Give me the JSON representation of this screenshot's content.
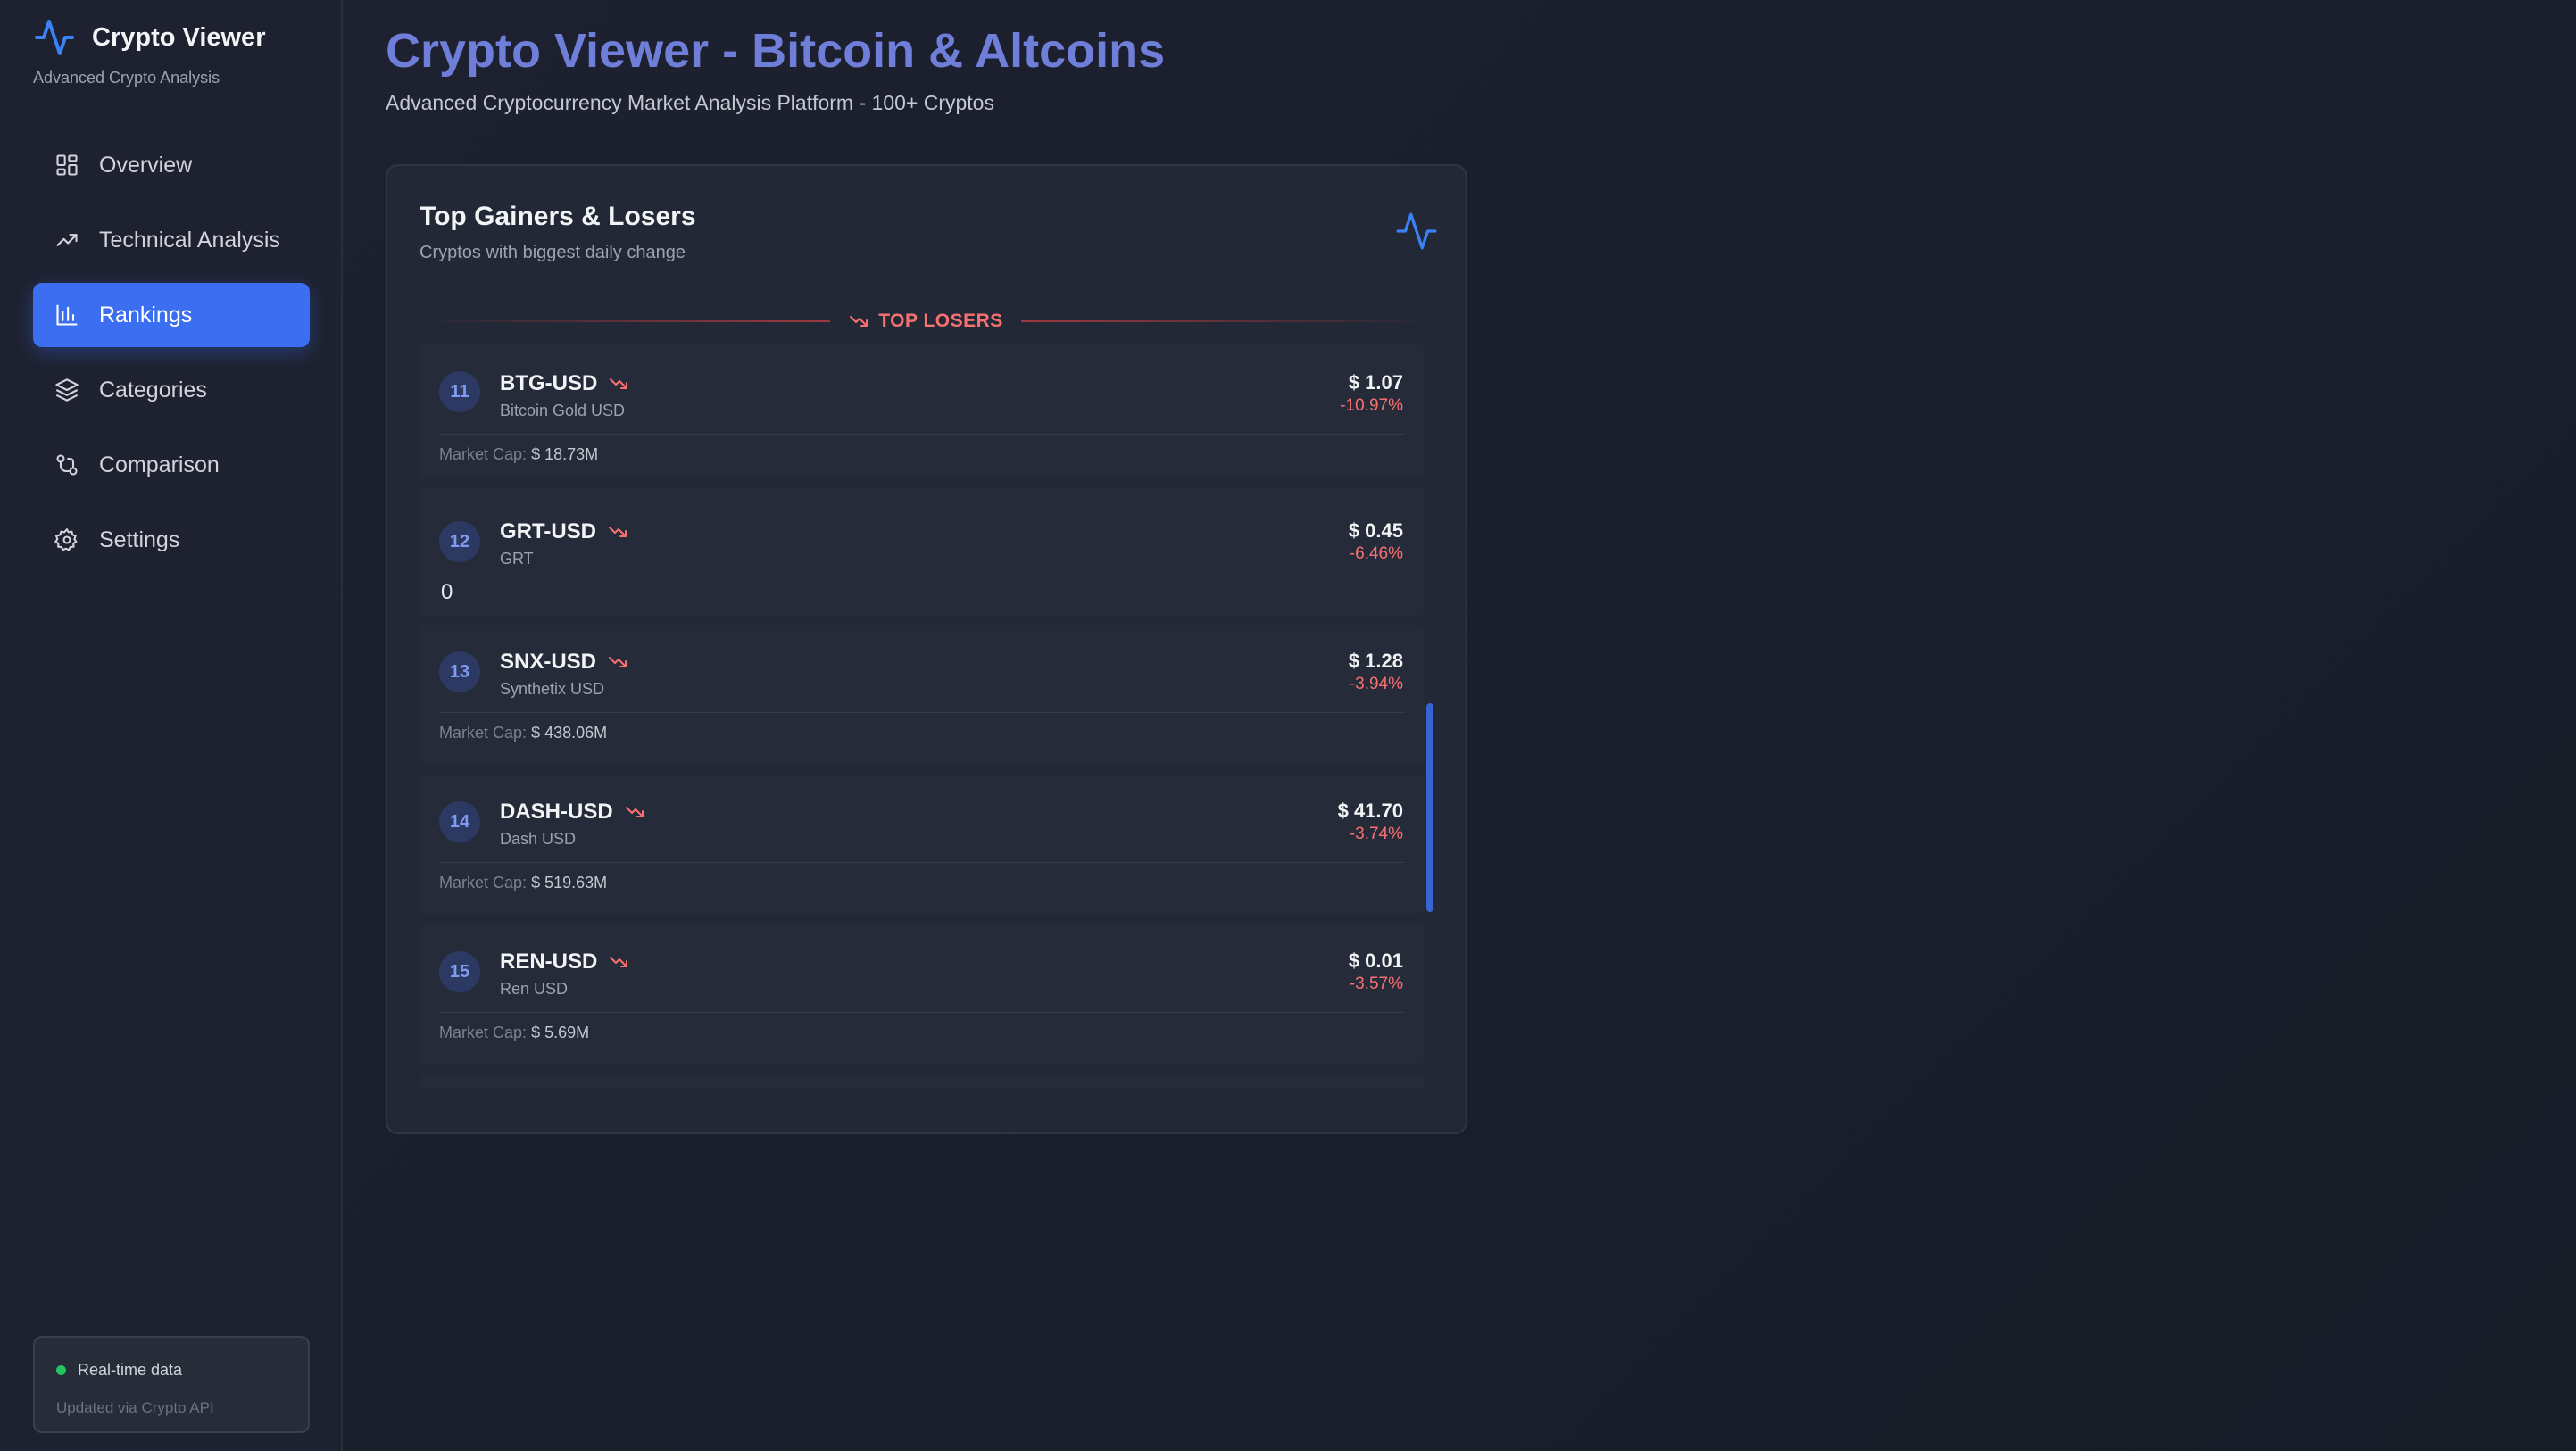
{
  "app": {
    "title": "Crypto Viewer",
    "subtitle": "Advanced Crypto Analysis"
  },
  "nav": [
    {
      "label": "Overview",
      "icon": "grid-icon",
      "active": false
    },
    {
      "label": "Technical Analysis",
      "icon": "trending-up-icon",
      "active": false
    },
    {
      "label": "Rankings",
      "icon": "bar-chart-icon",
      "active": true
    },
    {
      "label": "Categories",
      "icon": "layers-icon",
      "active": false
    },
    {
      "label": "Comparison",
      "icon": "git-compare-icon",
      "active": false
    },
    {
      "label": "Settings",
      "icon": "gear-icon",
      "active": false
    }
  ],
  "status": {
    "label": "Real-time data",
    "sub": "Updated via Crypto API",
    "color": "#22c55e"
  },
  "page": {
    "title": "Crypto Viewer - Bitcoin & Altcoins",
    "subtitle": "Advanced Cryptocurrency Market Analysis Platform - 100+ Cryptos"
  },
  "card": {
    "title": "Top Gainers & Losers",
    "subtitle": "Cryptos with biggest daily change",
    "section": "TOP LOSERS",
    "market_cap_label": "Market Cap:",
    "rows": [
      {
        "rank": "11",
        "symbol": "BTG-USD",
        "name": "Bitcoin Gold USD",
        "price": "$ 1.07",
        "change": "-10.97%",
        "market_cap": "$ 18.73M"
      },
      {
        "rank": "12",
        "symbol": "GRT-USD",
        "name": "GRT",
        "price": "$ 0.45",
        "change": "-6.46%",
        "market_cap": "0"
      },
      {
        "rank": "13",
        "symbol": "SNX-USD",
        "name": "Synthetix USD",
        "price": "$ 1.28",
        "change": "-3.94%",
        "market_cap": "$ 438.06M"
      },
      {
        "rank": "14",
        "symbol": "DASH-USD",
        "name": "Dash USD",
        "price": "$ 41.70",
        "change": "-3.74%",
        "market_cap": "$ 519.63M"
      },
      {
        "rank": "15",
        "symbol": "REN-USD",
        "name": "Ren USD",
        "price": "$ 0.01",
        "change": "-3.57%",
        "market_cap": "$ 5.69M"
      }
    ]
  },
  "colors": {
    "accent": "#3b6ef0",
    "title": "#6f7fd9",
    "loss": "#f87171"
  }
}
